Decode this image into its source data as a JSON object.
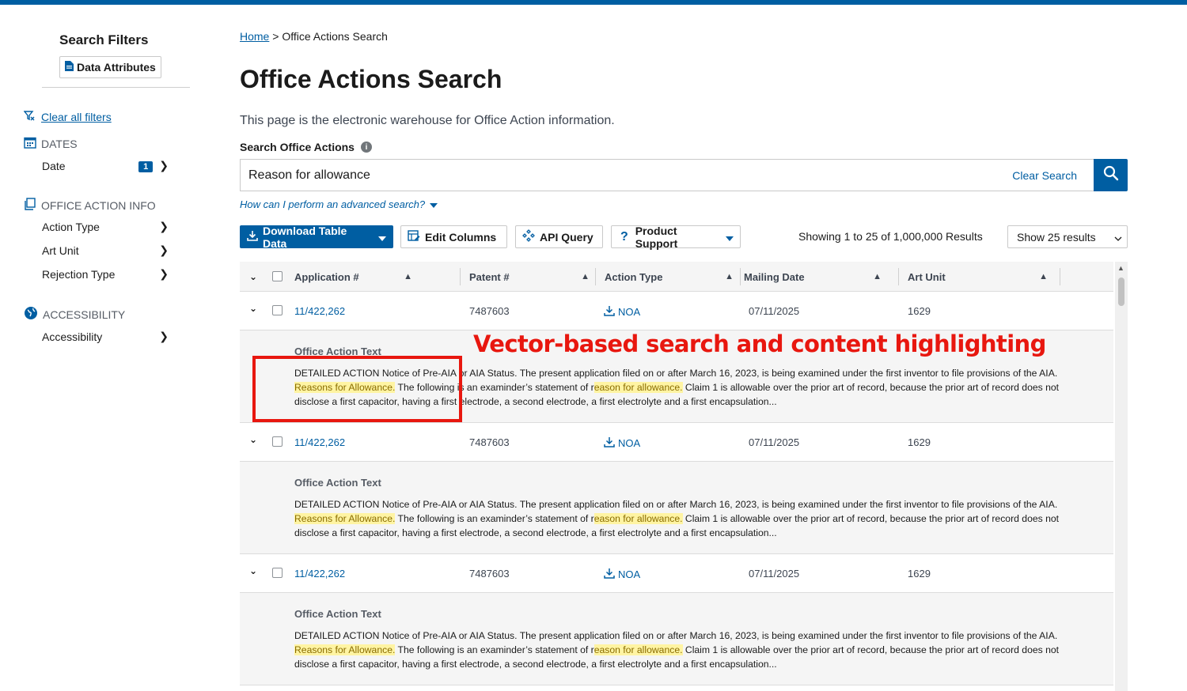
{
  "sidebar": {
    "title": "Search Filters",
    "data_attributes": "Data Attributes",
    "clear_all": "Clear all filters",
    "sections": {
      "dates": {
        "title": "DATES",
        "items": [
          {
            "label": "Date",
            "badge": "1"
          }
        ]
      },
      "office_action_info": {
        "title": "OFFICE ACTION INFO",
        "items": [
          {
            "label": "Action Type"
          },
          {
            "label": "Art Unit"
          },
          {
            "label": "Rejection Type"
          }
        ]
      },
      "accessibility": {
        "title": "ACCESSIBILITY",
        "items": [
          {
            "label": "Accessibility"
          }
        ]
      }
    }
  },
  "breadcrumb": {
    "home": "Home",
    "separator": ">",
    "current": "Office Actions Search"
  },
  "page": {
    "title": "Office Actions Search",
    "description": "This page is the electronic warehouse for Office Action information."
  },
  "search": {
    "label": "Search Office Actions",
    "value": "Reason for allowance",
    "clear": "Clear Search",
    "advanced": "How can I perform an advanced search?"
  },
  "toolbar": {
    "download": "Download Table Data",
    "edit_columns": "Edit Columns",
    "api_query": "API Query",
    "product_support": "Product Support",
    "results_count": "Showing 1 to 25 of 1,000,000 Results",
    "show_results": "Show 25 results"
  },
  "table": {
    "columns": [
      "Application #",
      "Patent #",
      "Action Type",
      "Mailing Date",
      "Art Unit"
    ],
    "detail_title": "Office Action Text",
    "rows": [
      {
        "application": "11/422,262",
        "patent": "7487603",
        "action_type": "NOA",
        "mailing_date": "07/11/2025",
        "art_unit": "1629",
        "text": {
          "t1": "DETAILED ACTION Notice of Pre-AIA or AIA Status. The present application filed on or after March 16, 2023, is being examined under the first inventor to file provisions of the AIA.",
          "h1": "Reasons for Allowance.",
          "t2": " The following is an examinder’s statement of r",
          "h2": "eason for allowance.",
          "t3": " Claim 1 is allowable over the prior art of record, because the prior art of record does not disclose a first capacitor, having a first electrode, a second electrode, a first electrolyte and a first encapsulation..."
        }
      },
      {
        "application": "11/422,262",
        "patent": "7487603",
        "action_type": "NOA",
        "mailing_date": "07/11/2025",
        "art_unit": "1629",
        "text": {
          "t1": "DETAILED ACTION Notice of Pre-AIA or AIA Status. The present application filed on or after March 16, 2023, is being examined under the first inventor to file provisions of the AIA.",
          "h1": "Reasons for Allowance.",
          "t2": " The following is an examinder’s statement of r",
          "h2": "eason for allowance.",
          "t3": " Claim 1 is allowable over the prior art of record, because the prior art of record does not disclose a first capacitor, having a first electrode, a second electrode, a first electrolyte and a first encapsulation..."
        }
      },
      {
        "application": "11/422,262",
        "patent": "7487603",
        "action_type": "NOA",
        "mailing_date": "07/11/2025",
        "art_unit": "1629",
        "text": {
          "t1": "DETAILED ACTION Notice of Pre-AIA or AIA Status. The present application filed on or after March 16, 2023, is being examined under the first inventor to file provisions of the AIA.",
          "h1": "Reasons for Allowance.",
          "t2": " The following is an examinder’s statement of r",
          "h2": "eason for allowance.",
          "t3": " Claim 1 is allowable over the prior art of record, because the prior art of record does not disclose a first capacitor, having a first electrode, a second electrode, a first electrolyte and a first encapsulation..."
        }
      }
    ]
  },
  "annotation": {
    "title": "Vector-based search and content highlighting"
  },
  "colors": {
    "primary": "#005ea2",
    "highlight": "#fff4a3",
    "annotation": "#e8170f"
  }
}
